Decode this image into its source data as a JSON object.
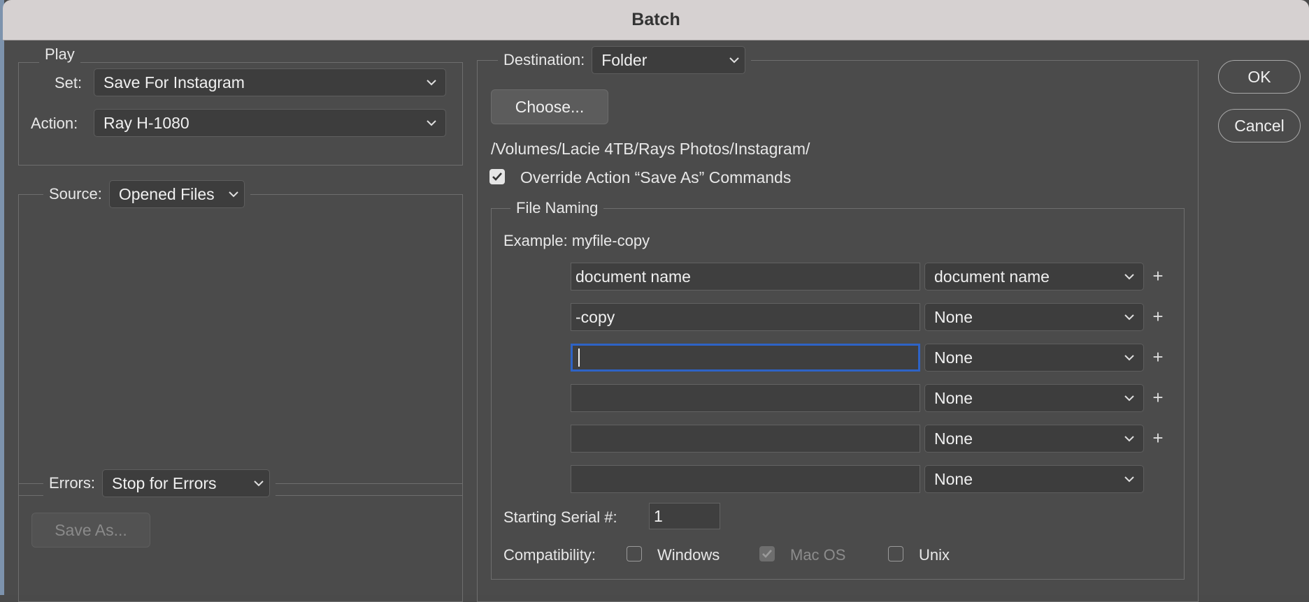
{
  "window": {
    "title": "Batch"
  },
  "play": {
    "legend": "Play",
    "set_label": "Set:",
    "set_value": "Save For Instagram",
    "action_label": "Action:",
    "action_value": "Ray H-1080"
  },
  "source": {
    "label": "Source:",
    "value": "Opened Files"
  },
  "errors": {
    "label": "Errors:",
    "value": "Stop for Errors",
    "save_as": "Save As..."
  },
  "destination": {
    "label": "Destination:",
    "value": "Folder",
    "choose": "Choose...",
    "path": "/Volumes/Lacie 4TB/Rays Photos/Instagram/",
    "override_label": "Override Action “Save As” Commands",
    "override_checked": true
  },
  "file_naming": {
    "legend": "File Naming",
    "example": "Example: myfile-copy",
    "rows": [
      {
        "text": "document name",
        "select": "document name",
        "plus": "+"
      },
      {
        "text": "-copy",
        "select": "None",
        "plus": "+"
      },
      {
        "text": "",
        "select": "None",
        "plus": "+"
      },
      {
        "text": "",
        "select": "None",
        "plus": "+"
      },
      {
        "text": "",
        "select": "None",
        "plus": "+"
      },
      {
        "text": "",
        "select": "None",
        "plus": ""
      }
    ],
    "serial_label": "Starting Serial #:",
    "serial_value": "1",
    "compat_label": "Compatibility:",
    "windows": "Windows",
    "macos": "Mac OS",
    "unix": "Unix"
  },
  "buttons": {
    "ok": "OK",
    "cancel": "Cancel"
  }
}
